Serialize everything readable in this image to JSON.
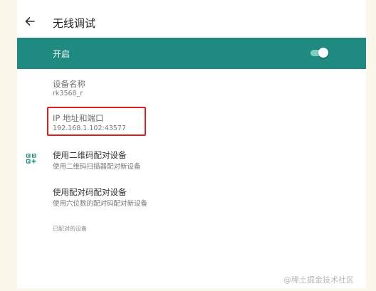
{
  "appbar": {
    "title": "无线调试",
    "back_icon": "arrow-back-icon"
  },
  "toggle": {
    "label": "开启",
    "state": "on",
    "colors": {
      "bar": "#1e8a80",
      "track": "#7fcfc5",
      "thumb": "#ffffff"
    }
  },
  "device": {
    "name_label": "设备名称",
    "name_value": "rk3568_r"
  },
  "ip": {
    "label": "IP 地址和端口",
    "value": "192.168.1.102:43577",
    "highlight_color": "#e21e1e"
  },
  "pair_qr": {
    "title": "使用二维码配对设备",
    "subtitle": "使用二维码扫描器配对新设备",
    "icon": "qr-code-add-icon"
  },
  "pair_code": {
    "title": "使用配对码配对设备",
    "subtitle": "使用六位数的配对码配对新设备"
  },
  "paired_section": {
    "header": "已配对的设备"
  },
  "watermark": "@稀土掘金技术社区"
}
